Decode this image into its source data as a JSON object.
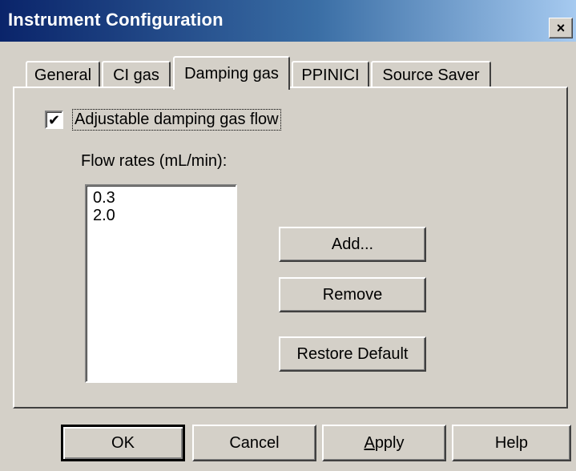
{
  "window": {
    "title": "Instrument Configuration",
    "close_glyph": "×"
  },
  "tabs": [
    {
      "label": "General",
      "active": false
    },
    {
      "label": "CI gas",
      "active": false
    },
    {
      "label": "Damping gas",
      "active": true
    },
    {
      "label": "PPINICI",
      "active": false
    },
    {
      "label": "Source Saver",
      "active": false
    }
  ],
  "damping": {
    "checkbox_label": "Adjustable damping gas flow",
    "checked": true,
    "check_glyph": "✔",
    "flow_rates_label": "Flow rates (mL/min):",
    "flow_rates": [
      "0.3",
      "2.0"
    ]
  },
  "buttons": {
    "add": "Add...",
    "remove": "Remove",
    "restore": "Restore Default",
    "ok": "OK",
    "cancel": "Cancel",
    "apply_mnemonic": "A",
    "apply_rest": "pply",
    "help": "Help"
  },
  "icons": {
    "close": "close-icon",
    "check": "checkmark-icon"
  },
  "colors": {
    "face": "#d4d0c8",
    "title_start": "#0a246a",
    "title_end": "#a6caf0"
  }
}
